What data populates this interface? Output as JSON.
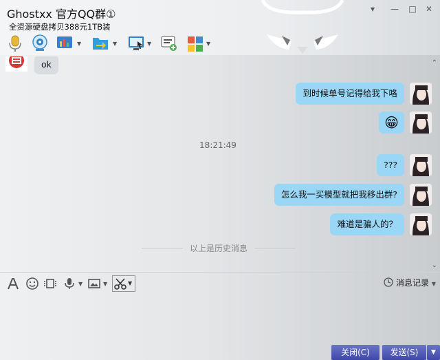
{
  "window": {
    "title": "Ghostxx 官方QQ群①",
    "subtitle": "全资源硬盘拷贝388元1TB装"
  },
  "messages": [
    {
      "side": "left",
      "text": "ok"
    },
    {
      "side": "right",
      "text": "到时候单号记得给我下咯"
    },
    {
      "side": "right",
      "text": "😁"
    },
    {
      "side": "right",
      "text": "???"
    },
    {
      "side": "right",
      "text": "怎么我一买模型就把我移出群?"
    },
    {
      "side": "right",
      "text": "难道是骗人的？"
    }
  ],
  "timestamp": "18:21:49",
  "history_label": "以上是历史消息",
  "input_toolbar": {
    "history_button": "消息记录"
  },
  "buttons": {
    "close": "关闭(C)",
    "send": "发送(S)"
  },
  "colors": {
    "my_bubble": "#9ad6f5",
    "their_bubble": "#d9dde1",
    "button": "#4a54b4"
  }
}
